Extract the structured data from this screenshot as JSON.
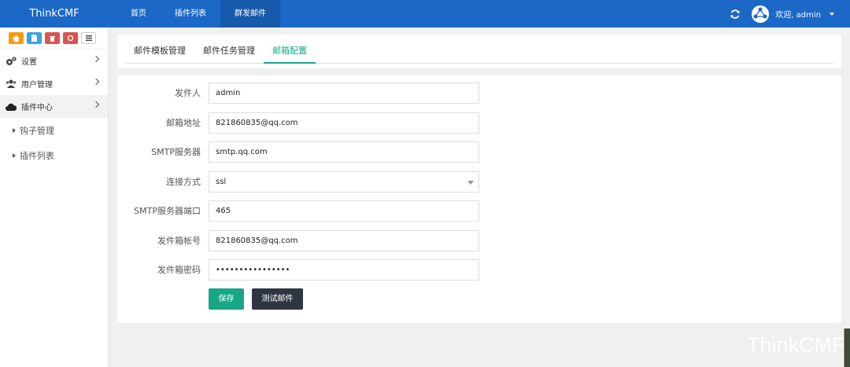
{
  "header": {
    "brand": "ThinkCMF",
    "nav": [
      "首页",
      "插件列表",
      "群发邮件"
    ],
    "user_greeting": "欢迎, admin"
  },
  "sidebar": {
    "shortcuts": [
      "home-icon",
      "file-icon",
      "trash-icon",
      "recycle-icon",
      "list-icon"
    ],
    "items": [
      {
        "label": "设置",
        "icon": "gears-icon"
      },
      {
        "label": "用户管理",
        "icon": "users-icon"
      },
      {
        "label": "插件中心",
        "icon": "cloud-icon"
      }
    ],
    "sub_items": [
      "钩子管理",
      "插件列表"
    ]
  },
  "tabs": [
    "邮件模板管理",
    "邮件任务管理",
    "邮箱配置"
  ],
  "form": {
    "sender_label": "发件人",
    "sender_value": "admin",
    "email_label": "邮箱地址",
    "email_value": "821860835@qq.com",
    "smtp_label": "SMTP服务器",
    "smtp_value": "smtp.qq.com",
    "conn_label": "连接方式",
    "conn_value": "ssl",
    "port_label": "SMTP服务器端口",
    "port_value": "465",
    "account_label": "发件箱帐号",
    "account_value": "821860835@qq.com",
    "password_label": "发件箱密码",
    "password_value": "••••••••••••••••",
    "save_label": "保存",
    "test_label": "测试邮件"
  },
  "watermark": "ThinkCMF",
  "colors": {
    "header": "#1b68c6",
    "accent": "#18a689",
    "dark_button": "#2f3542"
  }
}
